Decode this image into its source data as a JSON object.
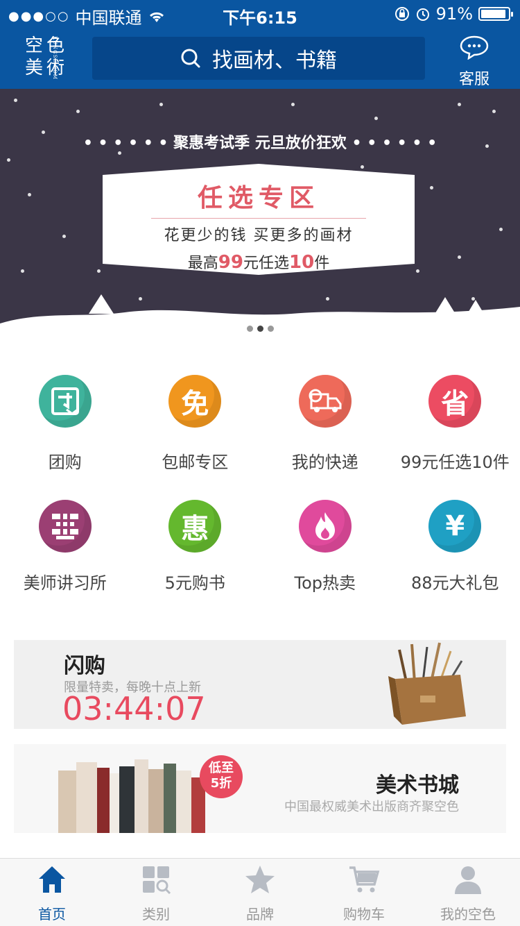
{
  "status_bar": {
    "signal": "●●●○○",
    "carrier": "中国联通",
    "time": "下午6:15",
    "battery": "91%",
    "battery_level": 0.91
  },
  "header": {
    "logo_text": [
      "空",
      "色",
      "美",
      "術"
    ],
    "logo_small": "KUNGSE.COM",
    "search_placeholder": "找画材、书籍",
    "service_label": "客服"
  },
  "banner": {
    "headline": "聚惠考试季 元旦放价狂欢",
    "card_title": "任选专区",
    "card_line2": "花更少的钱 买更多的画材",
    "card_line3_prefix": "最高",
    "card_line3_price": "99",
    "card_line3_mid": "元任选",
    "card_line3_count": "10",
    "card_line3_suffix": "件",
    "pager_total": 3,
    "pager_active": 2
  },
  "categories": [
    {
      "label": "团购",
      "icon": "group-buy-icon",
      "glyph": "团",
      "color": "#3fb39c"
    },
    {
      "label": "包邮专区",
      "icon": "free-shipping-icon",
      "glyph": "免",
      "color": "#f0961e"
    },
    {
      "label": "我的快递",
      "icon": "delivery-truck-icon",
      "glyph": "",
      "color": "#ee6a5a"
    },
    {
      "label": "99元任选10件",
      "icon": "save-icon",
      "glyph": "省",
      "color": "#ec4c62"
    },
    {
      "label": "美师讲习所",
      "icon": "lecture-icon",
      "glyph": "",
      "color": "#9b3f73"
    },
    {
      "label": "5元购书",
      "icon": "discount-icon",
      "glyph": "惠",
      "color": "#64b82e"
    },
    {
      "label": "Top热卖",
      "icon": "hot-fire-icon",
      "glyph": "",
      "color": "#e04a9c"
    },
    {
      "label": "88元大礼包",
      "icon": "yen-icon",
      "glyph": "¥",
      "color": "#1fa0c4"
    }
  ],
  "flash_sale": {
    "title": "闪购",
    "subtitle": "限量特卖，每晚十点上新",
    "countdown": "03:44:07"
  },
  "bookstore": {
    "badge_line1": "低至",
    "badge_line2": "5折",
    "title": "美术书城",
    "subtitle": "中国最权威美术出版商齐聚空色"
  },
  "tabbar": [
    {
      "label": "首页",
      "icon": "home-icon",
      "active": true
    },
    {
      "label": "类别",
      "icon": "category-icon",
      "active": false
    },
    {
      "label": "品牌",
      "icon": "star-icon",
      "active": false
    },
    {
      "label": "购物车",
      "icon": "cart-icon",
      "active": false
    },
    {
      "label": "我的空色",
      "icon": "user-icon",
      "active": false
    }
  ],
  "colors": {
    "brand": "#0a56a1",
    "accent": "#e84a5f",
    "banner_bg": "#3b3647"
  }
}
